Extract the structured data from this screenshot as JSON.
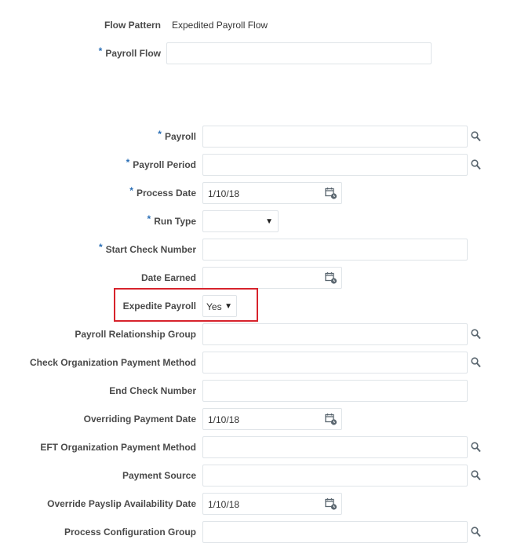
{
  "header": {
    "flow_pattern_label": "Flow Pattern",
    "flow_pattern_value": "Expedited Payroll Flow",
    "payroll_flow_label": "Payroll Flow",
    "payroll_flow_value": ""
  },
  "required_marker": "*",
  "fields": {
    "payroll": {
      "label": "Payroll",
      "value": ""
    },
    "payroll_period": {
      "label": "Payroll Period",
      "value": ""
    },
    "process_date": {
      "label": "Process Date",
      "value": "1/10/18"
    },
    "run_type": {
      "label": "Run Type",
      "value": ""
    },
    "start_check_number": {
      "label": "Start Check Number",
      "value": ""
    },
    "date_earned": {
      "label": "Date Earned",
      "value": ""
    },
    "expedite_payroll": {
      "label": "Expedite Payroll",
      "value": "Yes"
    },
    "payroll_relationship_group": {
      "label": "Payroll Relationship Group",
      "value": ""
    },
    "check_org_payment_method": {
      "label": "Check Organization Payment Method",
      "value": ""
    },
    "end_check_number": {
      "label": "End Check Number",
      "value": ""
    },
    "overriding_payment_date": {
      "label": "Overriding Payment Date",
      "value": "1/10/18"
    },
    "eft_org_payment_method": {
      "label": "EFT Organization Payment Method",
      "value": ""
    },
    "payment_source": {
      "label": "Payment Source",
      "value": ""
    },
    "override_payslip_availability_date": {
      "label": "Override Payslip Availability Date",
      "value": "1/10/18"
    },
    "process_configuration_group": {
      "label": "Process Configuration Group",
      "value": ""
    }
  },
  "icons": {
    "search": "search-icon",
    "calendar": "calendar-icon",
    "dropdown": "chevron-down-icon"
  },
  "colors": {
    "required_asterisk": "#2b6fb6",
    "highlight_box": "#d7232c",
    "input_border": "#dfe4e8"
  }
}
